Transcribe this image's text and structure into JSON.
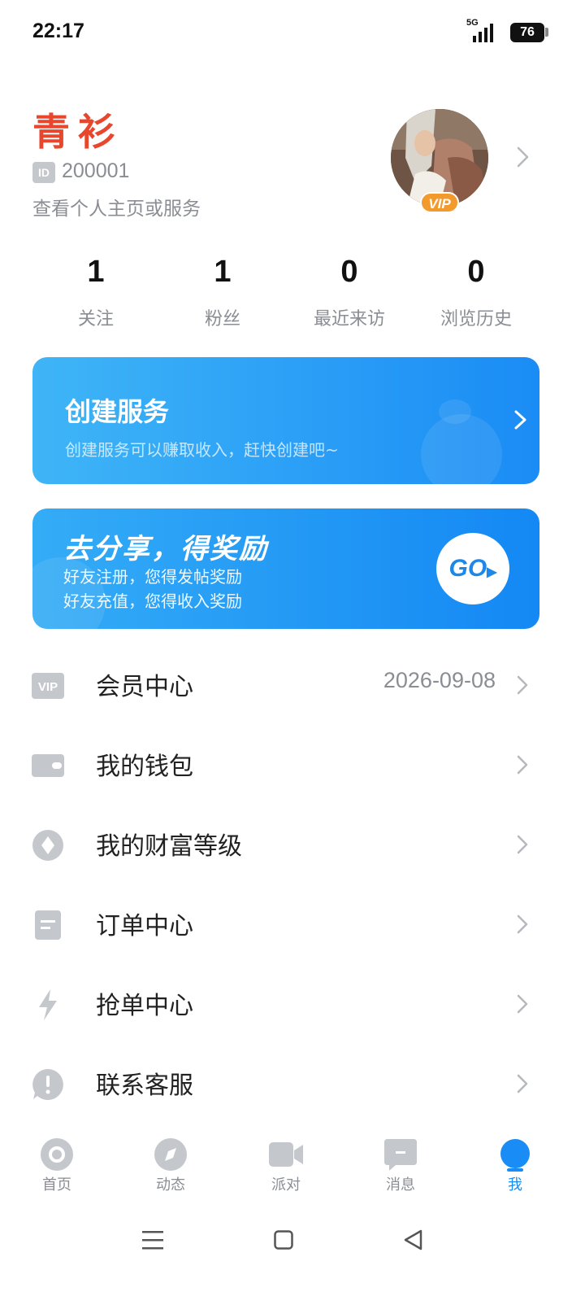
{
  "status_bar": {
    "time": "22:17",
    "network": "5G",
    "battery": "76"
  },
  "profile": {
    "name": "青衫",
    "id_label": "ID",
    "id_value": "200001",
    "subtitle": "查看个人主页或服务",
    "vip_badge": "VIP"
  },
  "stats": [
    {
      "value": "1",
      "label": "关注"
    },
    {
      "value": "1",
      "label": "粉丝"
    },
    {
      "value": "0",
      "label": "最近来访"
    },
    {
      "value": "0",
      "label": "浏览历史"
    }
  ],
  "create_banner": {
    "title": "创建服务",
    "description": "创建服务可以赚取收入，赶快创建吧~"
  },
  "share_banner": {
    "title": "去分享，得奖励",
    "line1": "好友注册，您得发帖奖励",
    "line2": "好友充值，您得收入奖励",
    "go_label": "GO"
  },
  "menu": [
    {
      "label": "会员中心",
      "extra": "2026-09-08",
      "icon": "vip-icon"
    },
    {
      "label": "我的钱包",
      "extra": "",
      "icon": "wallet-icon"
    },
    {
      "label": "我的财富等级",
      "extra": "",
      "icon": "diamond-icon"
    },
    {
      "label": "订单中心",
      "extra": "",
      "icon": "document-icon"
    },
    {
      "label": "抢单中心",
      "extra": "",
      "icon": "lightning-icon"
    },
    {
      "label": "联系客服",
      "extra": "",
      "icon": "alert-icon"
    }
  ],
  "bottom_nav": [
    {
      "label": "首页",
      "icon": "home-icon"
    },
    {
      "label": "动态",
      "icon": "compass-icon"
    },
    {
      "label": "派对",
      "icon": "video-icon"
    },
    {
      "label": "消息",
      "icon": "message-icon"
    },
    {
      "label": "我",
      "icon": "profile-icon",
      "active": true
    }
  ],
  "colors": {
    "accent": "#1a8cf5",
    "name_red": "#e8472e",
    "icon_gray": "#c4c7cc",
    "vip_orange": "#f39a2c"
  }
}
